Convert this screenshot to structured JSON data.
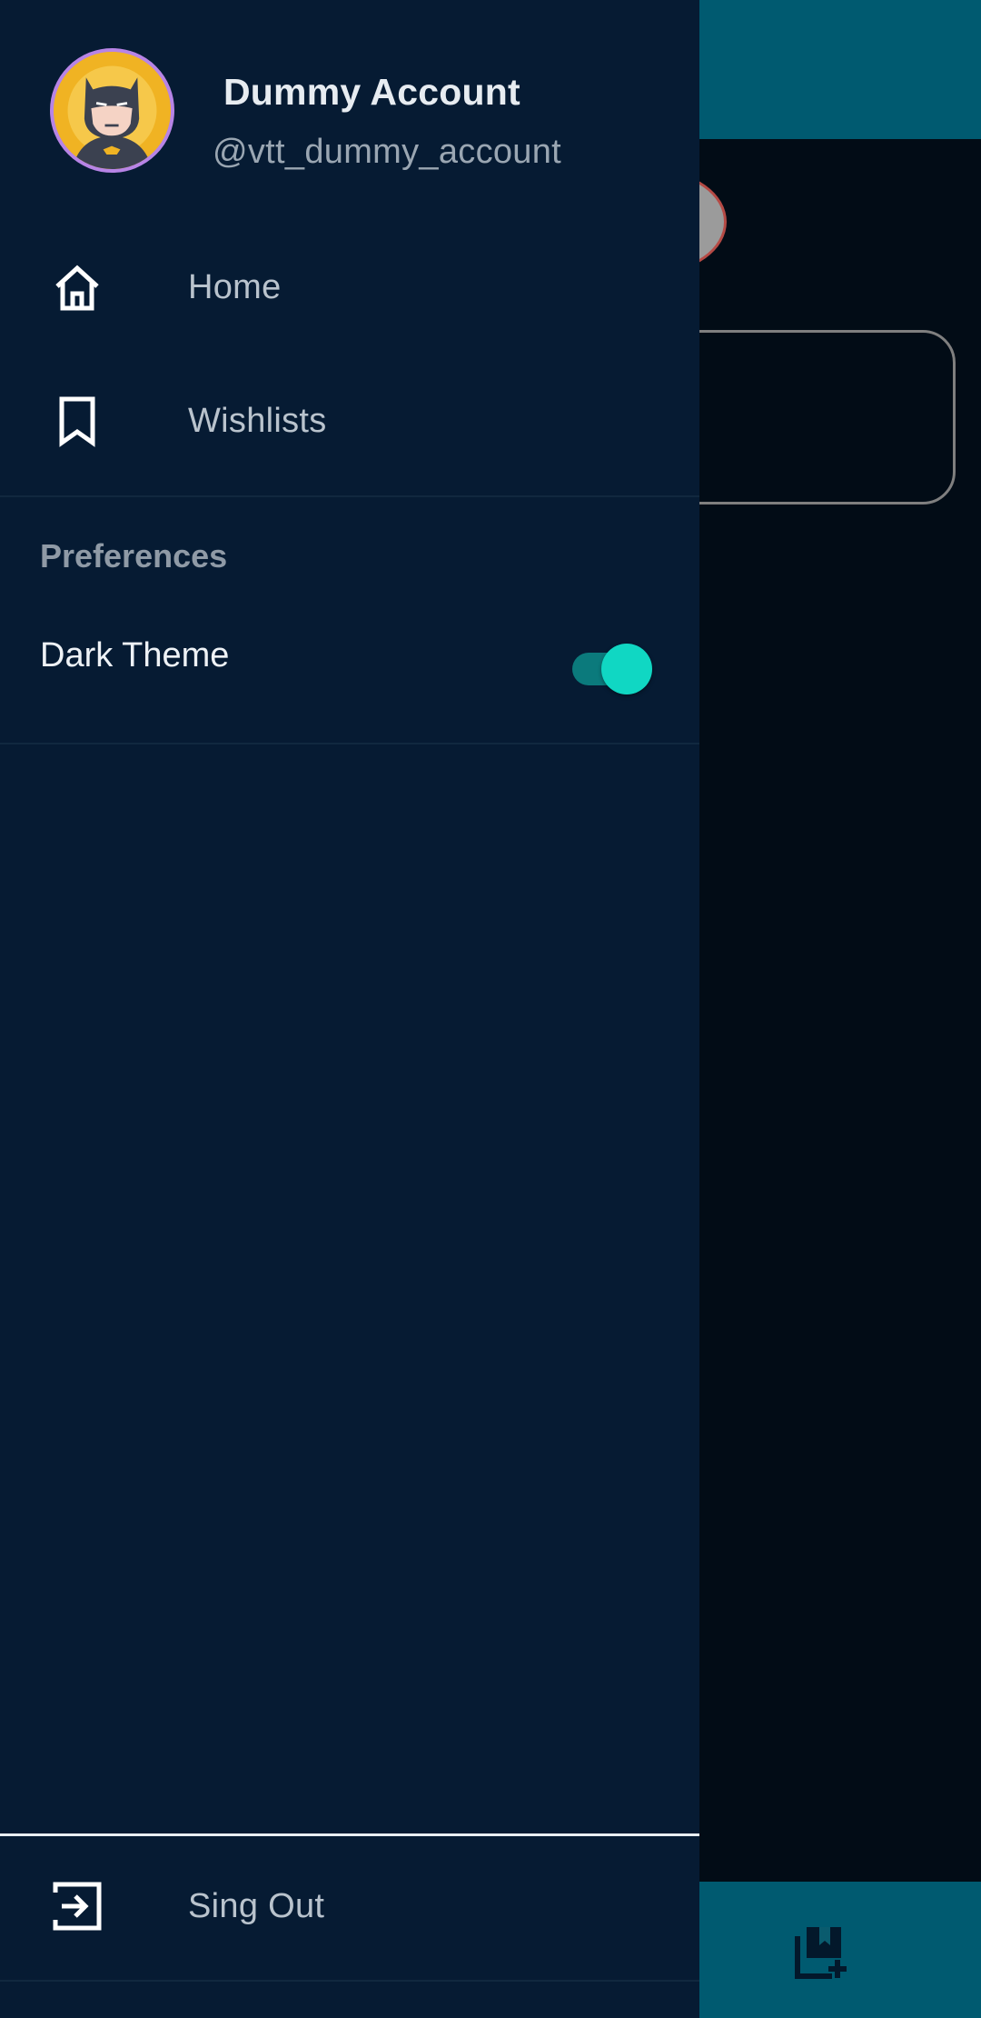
{
  "profile": {
    "name": "Dummy Account",
    "handle": "@vtt_dummy_account",
    "avatar_icon": "batman-avatar"
  },
  "nav": {
    "items": [
      {
        "label": "Home",
        "icon": "home-icon"
      },
      {
        "label": "Wishlists",
        "icon": "bookmark-icon"
      }
    ]
  },
  "preferences": {
    "title": "Preferences",
    "dark_theme": {
      "label": "Dark Theme",
      "enabled": true
    }
  },
  "footer": {
    "signout_label": "Sing Out",
    "signout_icon": "exit-icon"
  },
  "colors": {
    "drawer_bg": "#061b33",
    "accent": "#10d7c3",
    "app_bar": "#005a70"
  },
  "background": {
    "fab_icon": "add-bookmark-icon"
  }
}
